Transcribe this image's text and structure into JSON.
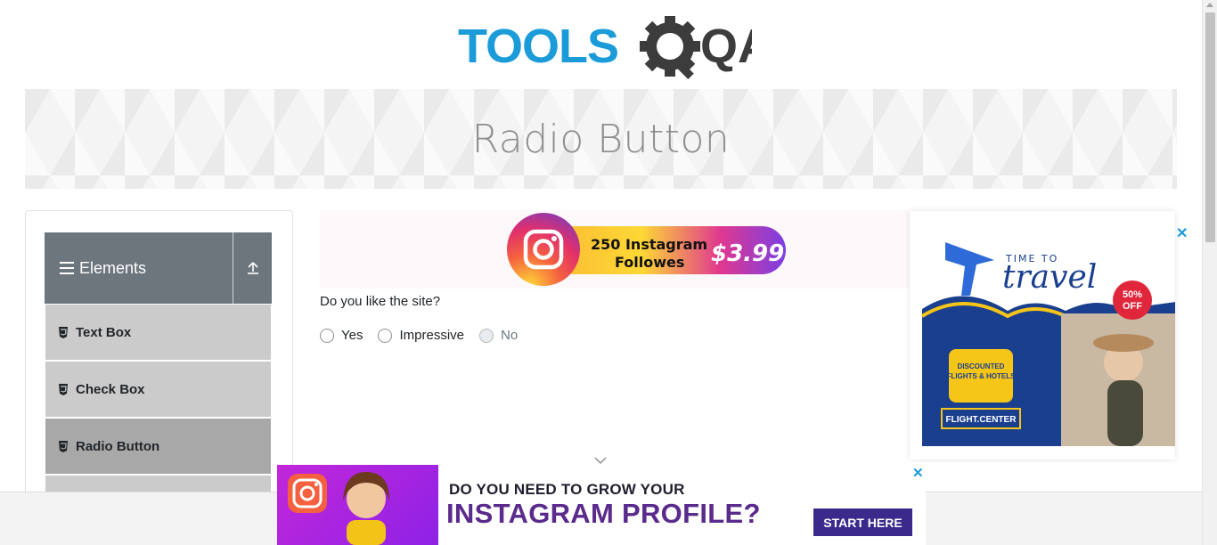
{
  "logo": {
    "text_left": "TOOLS",
    "text_right": "QA"
  },
  "banner": {
    "title": "Radio Button"
  },
  "sidebar": {
    "group_label": "Elements",
    "items": [
      {
        "label": "Text Box"
      },
      {
        "label": "Check Box"
      },
      {
        "label": "Radio Button"
      }
    ]
  },
  "form": {
    "question": "Do you like the site?",
    "options": [
      {
        "label": "Yes",
        "disabled": false
      },
      {
        "label": "Impressive",
        "disabled": false
      },
      {
        "label": "No",
        "disabled": true
      }
    ]
  },
  "ads": {
    "top": {
      "line1": "250 Instagram",
      "line2": "Followes",
      "price": "$3.99"
    },
    "right": {
      "line1": "TIME TO",
      "line2": "travel",
      "badge_top": "50%",
      "badge_bottom": "OFF",
      "card_line1": "DISCOUNTED",
      "card_line2": "FLIGHTS & HOTELS",
      "brand": "FLIGHT.CENTER",
      "close": "✕"
    },
    "bottom": {
      "line1": "DO YOU NEED TO GROW YOUR",
      "line2": "INSTAGRAM PROFILE?",
      "cta": "START HERE",
      "close": "✕"
    }
  },
  "colors": {
    "logo_blue": "#1b9bd8",
    "logo_dark": "#3c3c3c",
    "sidebar_header": "#6d757d",
    "menu_item": "#cbcbcb",
    "menu_item_active": "#a8a8a8"
  }
}
